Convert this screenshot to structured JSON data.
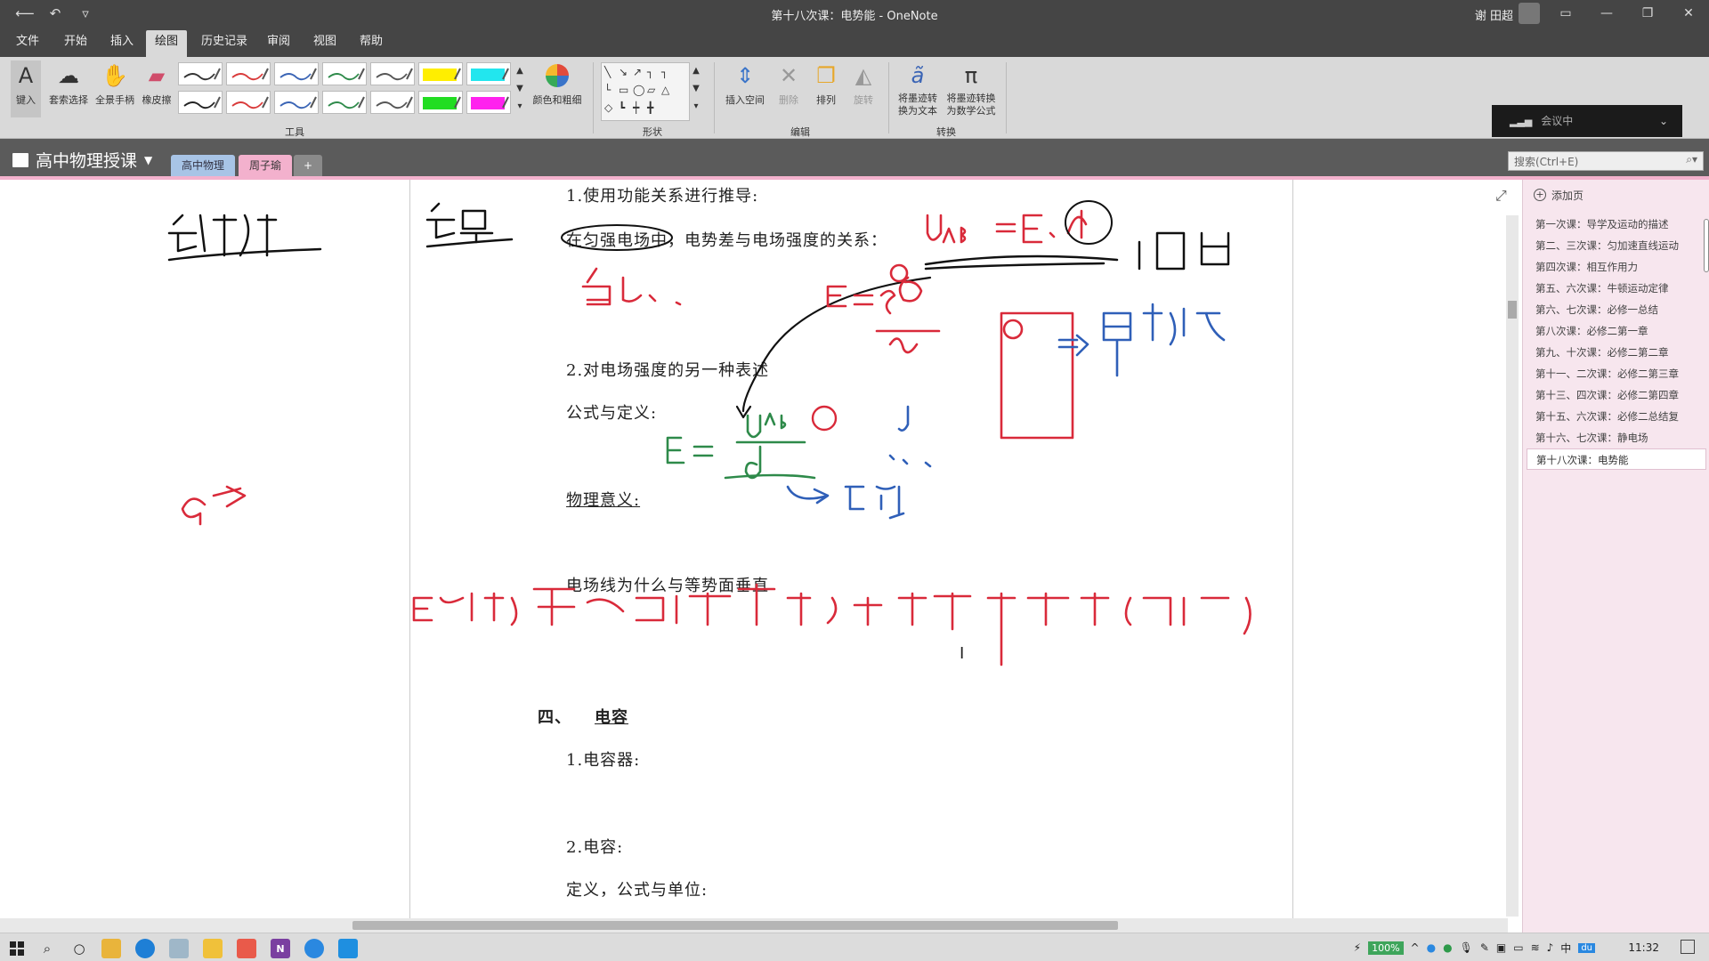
{
  "titlebar": {
    "title": "第十八次课：电势能 - OneNote",
    "user": "谢 田超",
    "back": "⟵",
    "undo": "↶",
    "customize": "▿",
    "win_ribbon": "▭",
    "win_min": "—",
    "win_max": "❐",
    "win_close": "✕"
  },
  "menu": {
    "tabs": [
      "文件",
      "开始",
      "插入",
      "绘图",
      "历史记录",
      "审阅",
      "视图",
      "帮助"
    ],
    "active": "绘图"
  },
  "ribbon": {
    "type_label": "键入",
    "lasso_label": "套索选择",
    "pan_label": "全景手柄",
    "eraser_label": "橡皮擦",
    "color_label": "颜色和粗细",
    "tools_group": "工具",
    "shapes_group": "形状",
    "insert_space": "插入空间",
    "delete": "删除",
    "arrange": "排列",
    "rotate": "旋转",
    "edit_group": "编辑",
    "ink_to_text": "将墨迹转换为文本",
    "ink_to_math": "将墨迹转换为数学公式",
    "convert_group": "转换",
    "pen_colors": [
      "#333333",
      "#d93a3a",
      "#3a64b5",
      "#2e8a4a",
      "#555555",
      "#ffee00",
      "#22e6ee",
      "#222222",
      "#d93a3a",
      "#3a64b5",
      "#2e8a4a",
      "#555555",
      "#22dd22",
      "#ff22ee"
    ],
    "meeting": "会议中"
  },
  "notebook": {
    "name": "高中物理授课",
    "sections": [
      "高中物理",
      "周子瑜"
    ],
    "add_section": "+",
    "search_placeholder": "搜索(Ctrl+E)"
  },
  "page": {
    "line1": "1.使用功能关系进行推导:",
    "line2": "在匀强电场中，电势差与电场强度的关系：",
    "line3": "2.对电场强度的另一种表述",
    "line4": "公式与定义:",
    "line5": "物理意义:",
    "line6": "电场线为什么与等势面垂直",
    "heading_num": "四、",
    "heading": "电容",
    "line7": "1.电容器:",
    "line8": "2.电容:",
    "line9": "定义，公式与单位:"
  },
  "pagelist": {
    "add_page": "添加页",
    "pages": [
      "第一次课：导学及运动的描述",
      "第二、三次课：匀加速直线运动",
      "第四次课：相互作用力",
      "第五、六次课：牛顿运动定律",
      "第六、七次课：必修一总结",
      "第八次课：必修二第一章",
      "第九、十次课：必修二第二章",
      "第十一、二次课：必修二第三章",
      "第十三、四次课：必修二第四章",
      "第十五、六次课：必修二总结复",
      "第十六、七次课：静电场",
      "第十八次课：电势能"
    ],
    "active_index": 11
  },
  "taskbar": {
    "zoom": "100%",
    "clock": "11:32",
    "search_icon": "⌕",
    "cortana_icon": "○",
    "tray_up": "^",
    "ime": "du"
  }
}
